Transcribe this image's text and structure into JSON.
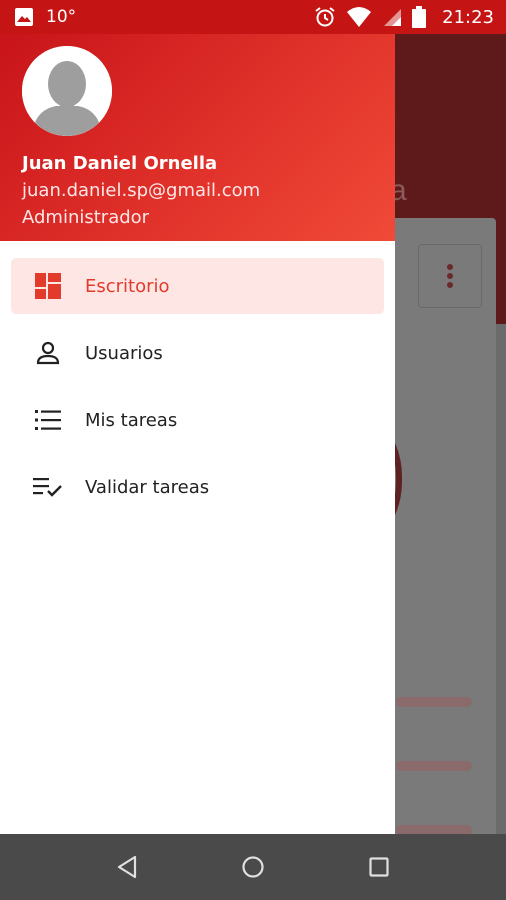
{
  "status_bar": {
    "temperature": "10°",
    "time": "21:23",
    "icons": [
      "image-icon",
      "alarm-icon",
      "wifi-icon",
      "signal-icon",
      "battery-icon"
    ]
  },
  "background_app": {
    "title_fragment": "a"
  },
  "drawer": {
    "user": {
      "name": "Juan Daniel Ornella",
      "email": "juan.daniel.sp@gmail.com",
      "role": "Administrador"
    },
    "items": [
      {
        "label": "Escritorio",
        "icon": "dashboard-icon",
        "active": true
      },
      {
        "label": "Usuarios",
        "icon": "person-icon",
        "active": false
      },
      {
        "label": "Mis tareas",
        "icon": "list-icon",
        "active": false
      },
      {
        "label": "Validar tareas",
        "icon": "playlist-check-icon",
        "active": false
      }
    ]
  },
  "nav_bar": {
    "buttons": [
      "back-icon",
      "home-icon",
      "recents-icon"
    ]
  },
  "colors": {
    "accent": "#e23b2c",
    "header_start": "#c8141a",
    "header_end": "#f04a38",
    "active_bg": "#fde6e4"
  }
}
